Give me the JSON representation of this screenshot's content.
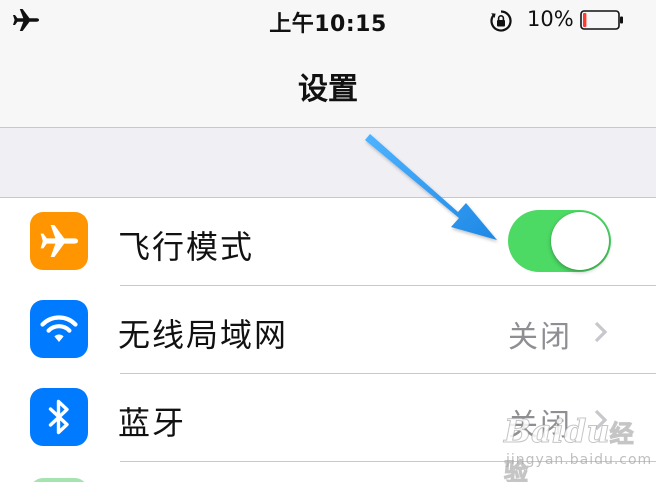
{
  "status_bar": {
    "time": "上午10:15",
    "battery_percent": "10%",
    "battery_level": 0.1,
    "icons": [
      "airplane-icon",
      "rotation-lock-icon",
      "battery-icon"
    ]
  },
  "nav": {
    "title": "设置"
  },
  "settings": {
    "items": [
      {
        "label": "飞行模式",
        "icon": "airplane-icon",
        "icon_color": "#ff9500",
        "control": "toggle",
        "toggle_on": true
      },
      {
        "label": "无线局域网",
        "icon": "wifi-icon",
        "icon_color": "#007aff",
        "value": "关闭",
        "control": "disclosure"
      },
      {
        "label": "蓝牙",
        "icon": "bluetooth-icon",
        "icon_color": "#007aff",
        "value": "关闭",
        "control": "disclosure"
      }
    ]
  },
  "colors": {
    "toggle_on": "#4cd964",
    "annotation_arrow": "#2196f3",
    "battery_low": "#ff3b30"
  },
  "watermark": {
    "brand": "Baidu",
    "brand_cn": "经验",
    "url": "jingyan.baidu.com"
  }
}
